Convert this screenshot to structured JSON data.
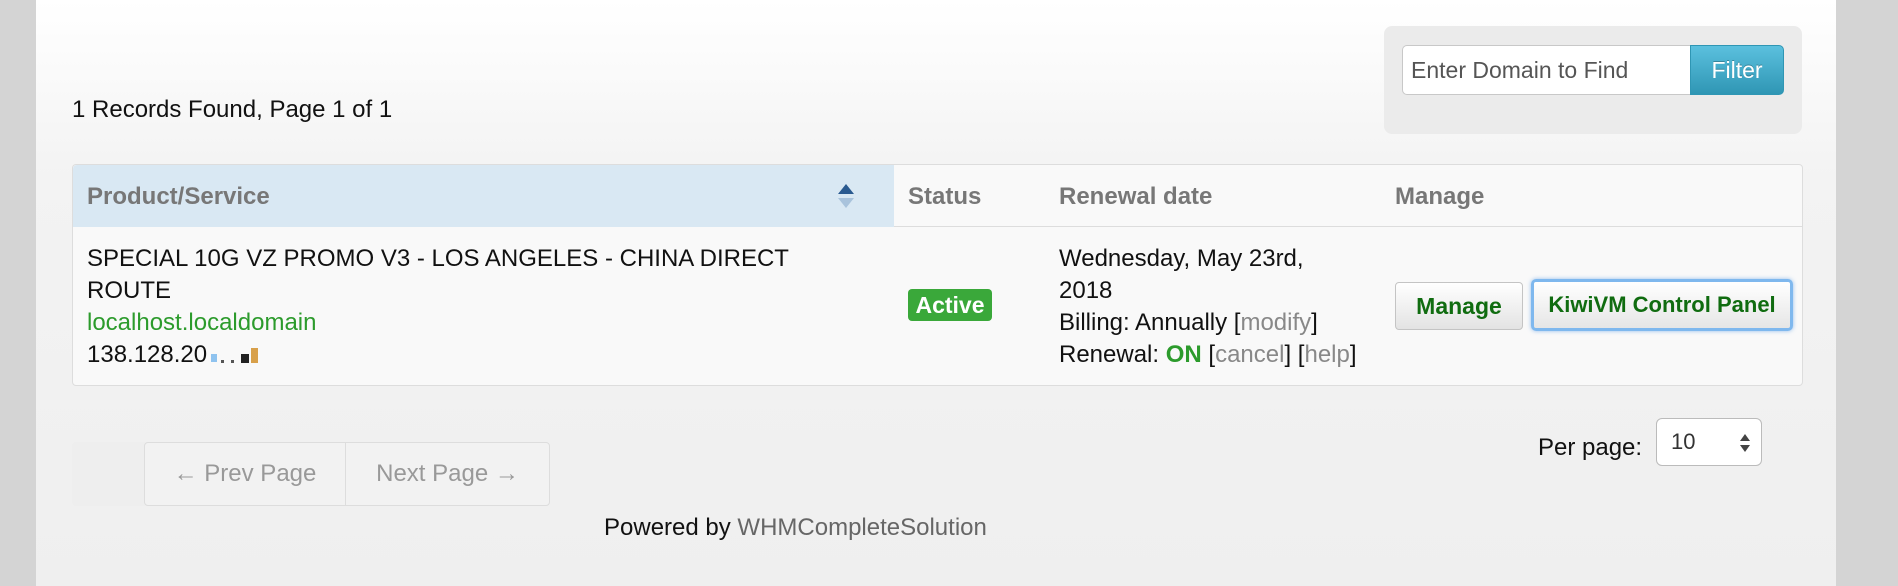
{
  "header": {
    "records_text": "1 Records Found, Page 1 of 1",
    "filter": {
      "placeholder": "Enter Domain to Find",
      "button_label": "Filter"
    }
  },
  "table": {
    "columns": [
      "Product/Service",
      "Status",
      "Renewal date",
      "Manage"
    ],
    "row": {
      "product_name": "SPECIAL 10G VZ PROMO V3 - LOS ANGELES - CHINA DIRECT ROUTE",
      "domain": "localhost.localdomain",
      "ip_prefix": "138.128.20",
      "status": "Active",
      "renewal_date": "Wednesday, May 23rd, 2018",
      "billing_label": "Billing: Annually",
      "modify_link": "modify",
      "renewal_label": "Renewal:",
      "renewal_state": "ON",
      "cancel_link": "cancel",
      "help_link": "help",
      "manage_button": "Manage",
      "control_panel_button": "KiwiVM Control Panel"
    }
  },
  "pager": {
    "prev_label": "← Prev Page",
    "next_label": "Next Page →"
  },
  "per_page": {
    "label": "Per page:",
    "value": "10"
  },
  "footer": {
    "powered_by": "Powered by",
    "link": "WHMCompleteSolution"
  },
  "colors": {
    "header_highlight": "#d9e8f3",
    "accent_green": "#2c9b2c",
    "badge_green": "#3aa83a",
    "filter_blue": "#2f96b4"
  }
}
